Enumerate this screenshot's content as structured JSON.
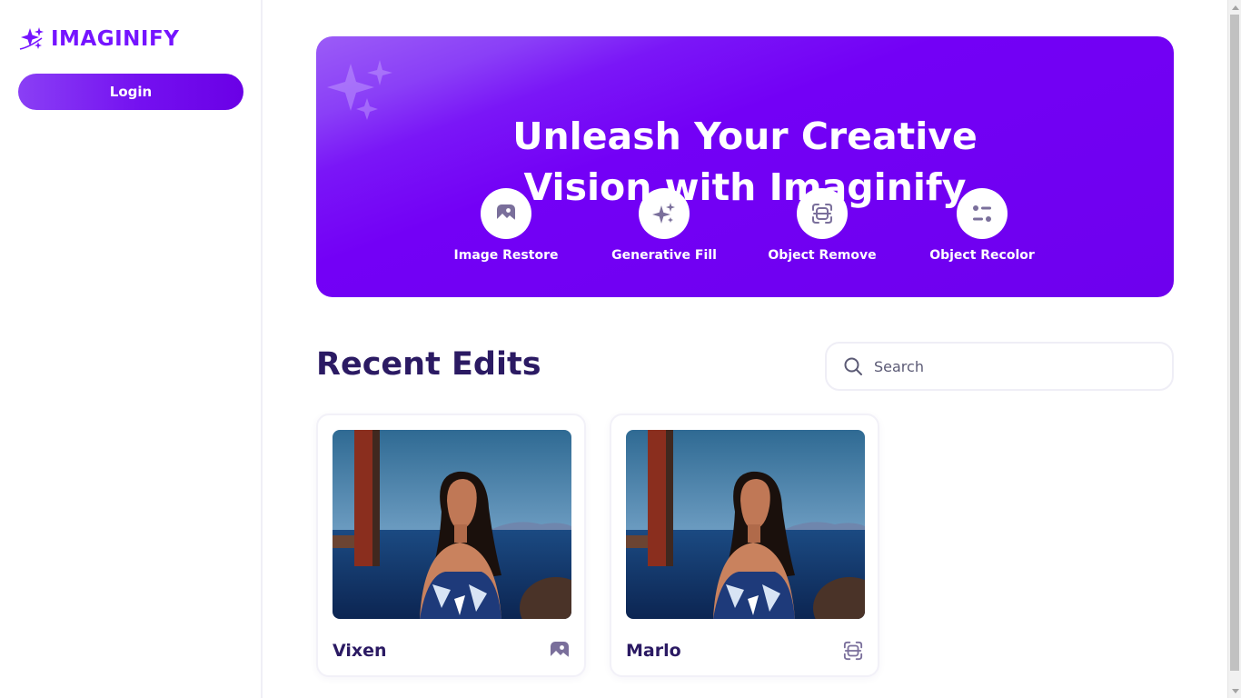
{
  "sidebar": {
    "logo_text": "IMAGINIFY",
    "login_label": "Login"
  },
  "hero": {
    "title_line1": "Unleash Your Creative",
    "title_line2": "Vision with Imaginify",
    "features": [
      {
        "label": "Image Restore",
        "icon": "image-icon"
      },
      {
        "label": "Generative Fill",
        "icon": "sparkles-icon"
      },
      {
        "label": "Object Remove",
        "icon": "scan-icon"
      },
      {
        "label": "Object Recolor",
        "icon": "filter-icon"
      }
    ]
  },
  "recent": {
    "title": "Recent Edits",
    "search_placeholder": "Search",
    "cards": [
      {
        "title": "Vixen",
        "type_icon": "image-icon"
      },
      {
        "title": "Marlo",
        "type_icon": "scan-icon"
      }
    ]
  },
  "colors": {
    "brand": "#7514ff",
    "heading": "#2b1a63",
    "hero_bg": "#7300f6"
  }
}
